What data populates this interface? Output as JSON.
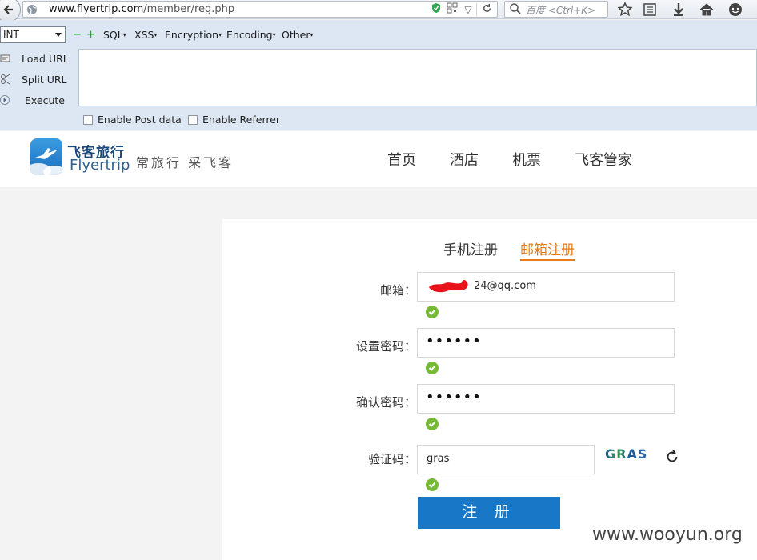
{
  "browser": {
    "url_host": "www.flyertrip.com",
    "url_path": "/member/reg.php",
    "search_placeholder": "百度 <Ctrl+K>"
  },
  "hackbar": {
    "select_value": "INT",
    "menus": [
      "SQL",
      "XSS",
      "Encryption",
      "Encoding",
      "Other"
    ],
    "actions": [
      "Load URL",
      "Split URL",
      "Execute"
    ],
    "checkboxes": [
      "Enable Post data",
      "Enable Referrer"
    ]
  },
  "site": {
    "logo_cn": "飞客旅行",
    "logo_en": "Flyertrip",
    "slogan": "常旅行 采飞客",
    "nav": [
      "首页",
      "酒店",
      "机票",
      "飞客管家"
    ]
  },
  "form": {
    "tabs": [
      "手机注册",
      "邮箱注册"
    ],
    "email_label": "邮箱：",
    "email_value": "24@qq.com",
    "password_label": "设置密码：",
    "password_value": "••••••",
    "confirm_label": "确认密码：",
    "confirm_value": "••••••",
    "captcha_label": "验证码：",
    "captcha_value": "gras",
    "captcha_image_text": "GRAS",
    "submit_label": "注 册"
  },
  "watermark": "www.wooyun.org",
  "colors": {
    "accent_orange": "#e97a17",
    "button_blue": "#1977c7",
    "check_green": "#75b936",
    "hackbar_bg": "#dce7f3"
  }
}
